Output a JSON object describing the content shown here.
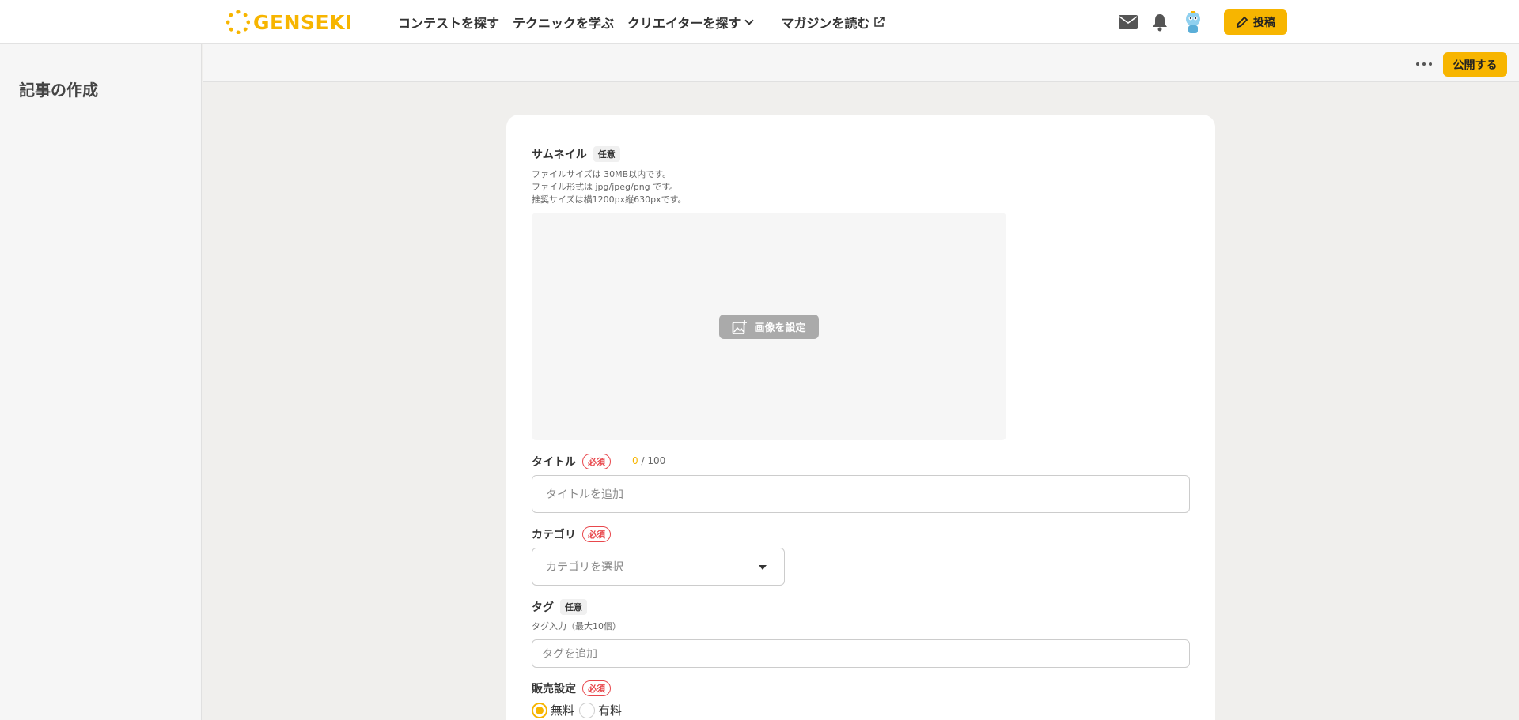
{
  "header": {
    "logo_text": "GENSEKI",
    "nav": [
      {
        "label": "コンテストを探す"
      },
      {
        "label": "テクニックを学ぶ"
      },
      {
        "label": "クリエイターを探す"
      },
      {
        "label": "マガジンを読む"
      }
    ],
    "post_button": "投稿",
    "icons": [
      "mail-icon",
      "bell-icon",
      "avatar",
      "pencil-icon"
    ]
  },
  "sidebar": {
    "title": "記事の作成"
  },
  "toolbar": {
    "publish_button": "公開する",
    "more_icon": "more-horizontal-icon"
  },
  "form": {
    "thumbnail": {
      "label": "サムネイル",
      "badge": "任意",
      "help": [
        "ファイルサイズは 30MB以内です。",
        "ファイル形式は jpg/jpeg/png です。",
        "推奨サイズは横1200px縦630pxです。"
      ],
      "set_image_button": "画像を設定"
    },
    "title": {
      "label": "タイトル",
      "badge": "必須",
      "count": "0",
      "max": "/ 100",
      "placeholder": "タイトルを追加"
    },
    "category": {
      "label": "カテゴリ",
      "badge": "必須",
      "placeholder": "カテゴリを選択"
    },
    "tags": {
      "label": "タグ",
      "badge": "任意",
      "help": "タグ入力（最大10個）",
      "placeholder": "タグを追加"
    },
    "sales": {
      "label": "販売設定",
      "badge": "必須",
      "options": [
        {
          "label": "無料",
          "selected": true
        },
        {
          "label": "有料",
          "selected": false
        }
      ]
    }
  },
  "colors": {
    "accent": "#f7b500",
    "required": "#e8474c"
  }
}
